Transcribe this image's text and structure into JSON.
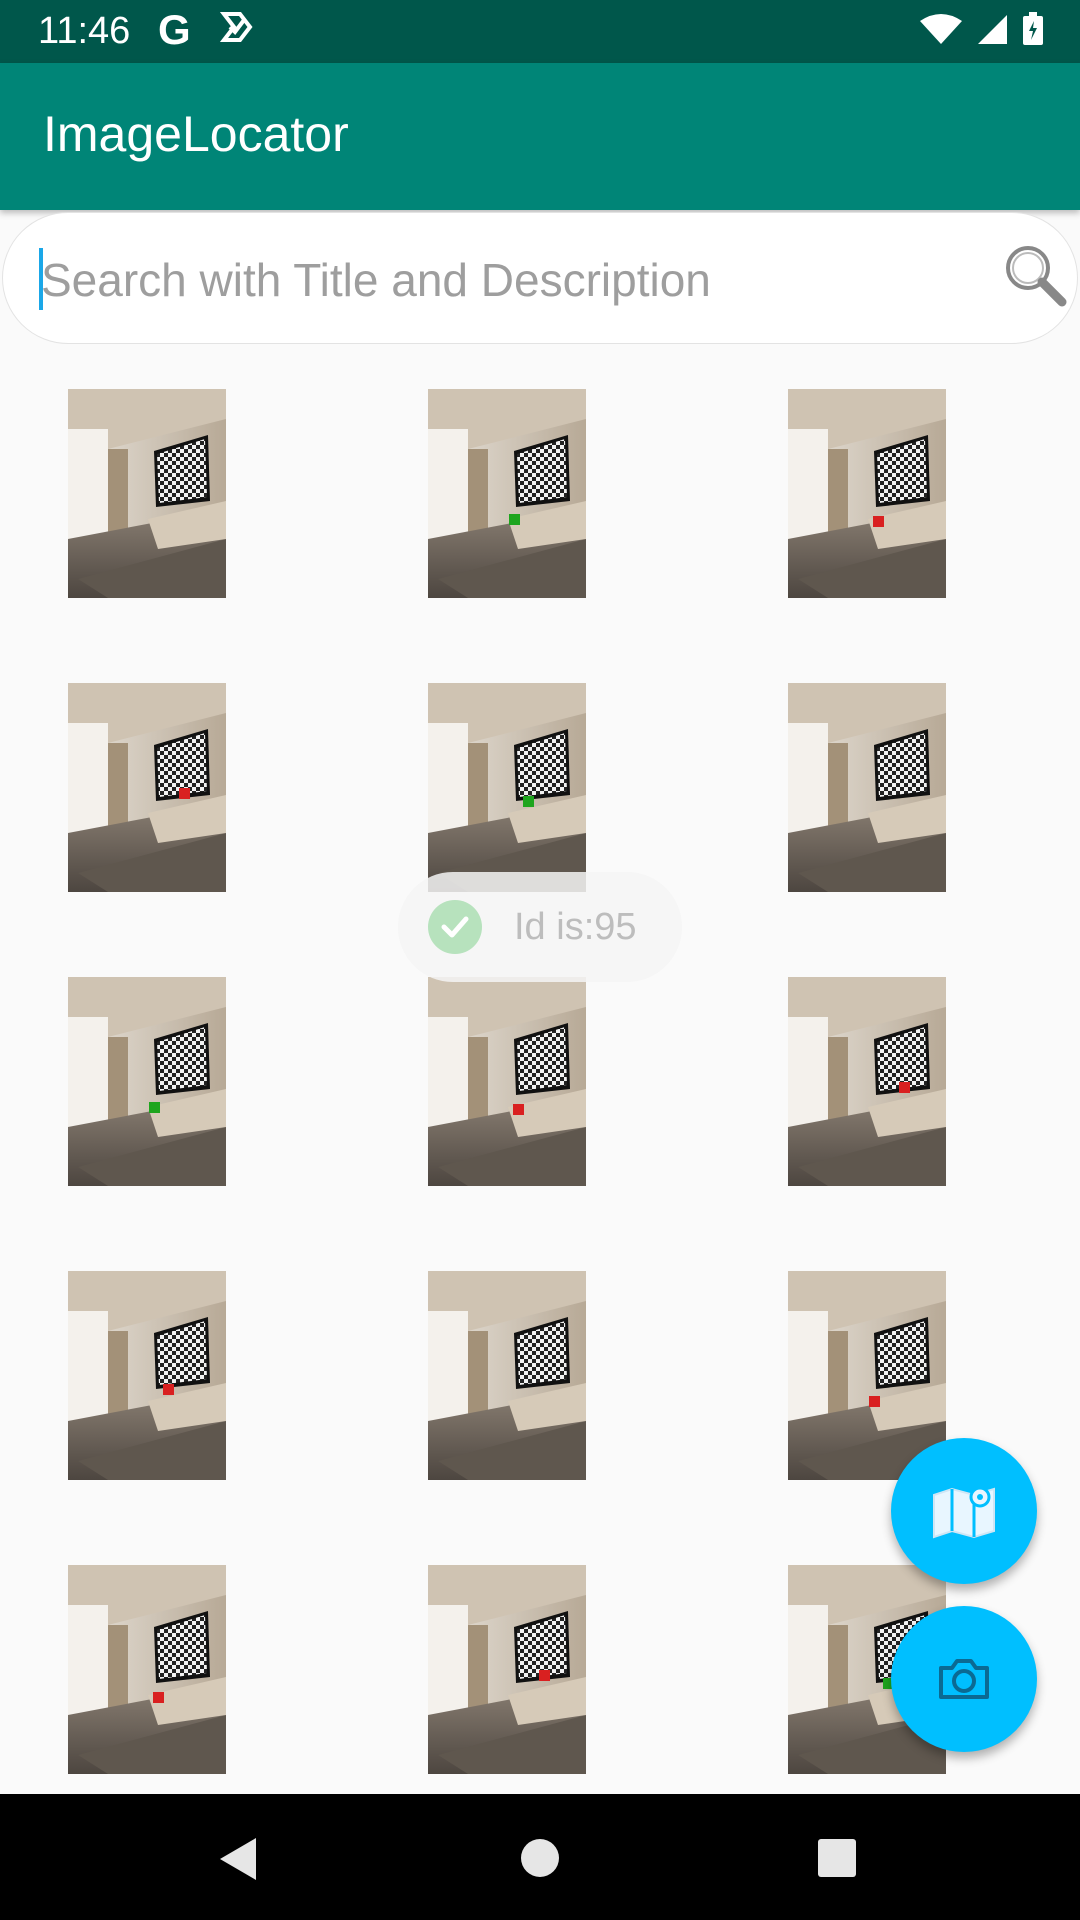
{
  "status_bar": {
    "time": "11:46",
    "google_letter": "G"
  },
  "app_bar": {
    "title": "ImageLocator"
  },
  "search": {
    "placeholder": "Search with Title and Description"
  },
  "toast": {
    "text": "Id is:95"
  },
  "grid": {
    "items": [
      {
        "dot": "green"
      },
      {
        "dot": "green"
      },
      {
        "dot": "red"
      },
      {
        "dot": "red"
      },
      {
        "dot": "green"
      },
      {
        "dot": "green"
      },
      {
        "dot": "green"
      },
      {
        "dot": "red"
      },
      {
        "dot": "red"
      },
      {
        "dot": "red"
      },
      {
        "dot": "red"
      },
      {
        "dot": "red"
      },
      {
        "dot": "red"
      },
      {
        "dot": "red"
      },
      {
        "dot": "green"
      }
    ]
  },
  "fabs": {
    "map_icon": "map-icon",
    "camera_icon": "camera-icon"
  },
  "colors": {
    "status_bar": "#00574b",
    "app_bar": "#008577",
    "fab": "#00bfff",
    "dot_green": "#1ea51e",
    "dot_red": "#d92020"
  }
}
